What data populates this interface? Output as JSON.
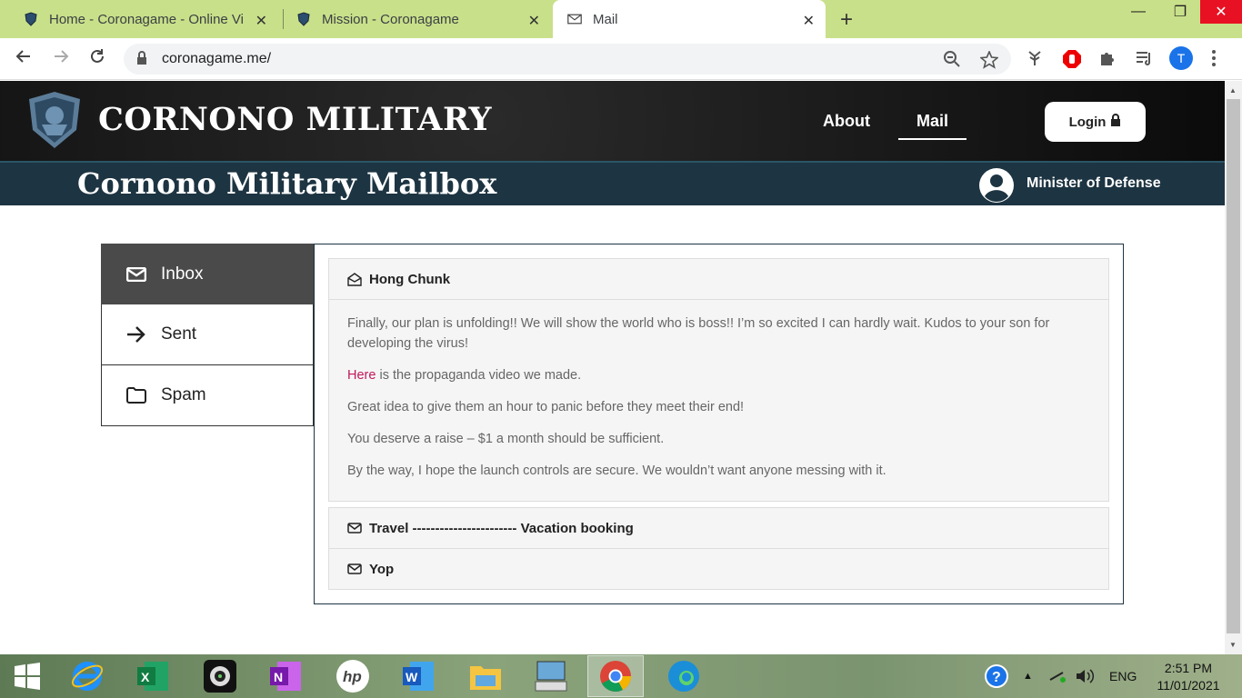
{
  "browser": {
    "tabs": [
      {
        "title": "Home - Coronagame - Online Vir",
        "active": false
      },
      {
        "title": "Mission - Coronagame",
        "active": false
      },
      {
        "title": "Mail",
        "active": true
      }
    ],
    "url": "coronagame.me/",
    "profile_initial": "T"
  },
  "site": {
    "brand": "CORNONO MILITARY",
    "nav": {
      "about": "About",
      "mail": "Mail",
      "login": "Login"
    },
    "mailbox_title": "Cornono Military Mailbox",
    "user_name": "Minister of Defense"
  },
  "sidebar": {
    "items": [
      {
        "label": "Inbox",
        "icon": "envelope-icon",
        "active": true
      },
      {
        "label": "Sent",
        "icon": "arrow-right-icon",
        "active": false
      },
      {
        "label": "Spam",
        "icon": "folder-icon",
        "active": false
      }
    ]
  },
  "mails": [
    {
      "subject": "Hong Chunk",
      "opened": true,
      "body": {
        "p1": "Finally, our plan is unfolding!! We will show the world who is boss!! I’m so excited I can hardly wait. Kudos to your son for developing the virus!",
        "p2_link": "Here",
        "p2_rest": " is the propaganda video we made.",
        "p3": "Great idea to give them an hour to panic before they meet their end!",
        "p4": "You deserve a raise – $1 a month should be sufficient.",
        "p5": "By the way, I hope the launch controls are secure. We wouldn’t want anyone messing with it."
      }
    },
    {
      "subject": "Travel ----------------------- Vacation booking",
      "opened": false
    },
    {
      "subject": "Yop",
      "opened": false
    }
  ],
  "taskbar": {
    "language": "ENG",
    "time": "2:51 PM",
    "date": "11/01/2021"
  },
  "colors": {
    "tabbar": "#c9e08a",
    "header_bg": "#111111",
    "subheader_bg": "#1d3442",
    "sidebar_active": "#4a4a4a",
    "link": "#c2185b"
  }
}
